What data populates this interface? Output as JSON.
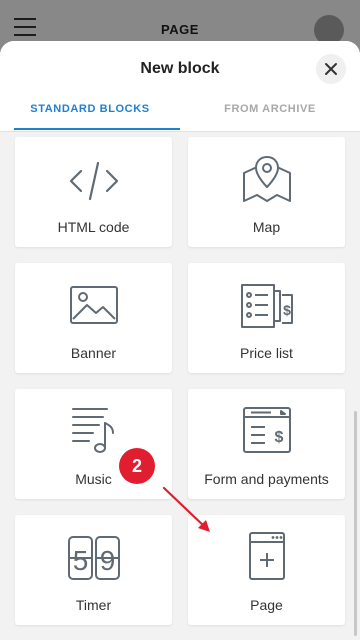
{
  "topbar": {
    "title": "PAGE"
  },
  "sheet": {
    "title": "New block",
    "tabs": [
      {
        "label": "STANDARD BLOCKS",
        "active": true
      },
      {
        "label": "FROM ARCHIVE",
        "active": false
      }
    ]
  },
  "blocks": [
    {
      "label": "HTML code",
      "icon": "code-icon"
    },
    {
      "label": "Map",
      "icon": "map-pin-icon"
    },
    {
      "label": "Banner",
      "icon": "image-icon"
    },
    {
      "label": "Price list",
      "icon": "price-list-icon"
    },
    {
      "label": "Music",
      "icon": "music-icon"
    },
    {
      "label": "Form and payments",
      "icon": "form-payment-icon"
    },
    {
      "label": "Timer",
      "icon": "timer-icon"
    },
    {
      "label": "Page",
      "icon": "page-add-icon"
    }
  ],
  "annotation": {
    "step": "2"
  },
  "colors": {
    "accent": "#1f7fd1",
    "badge": "#e01e30",
    "icon": "#5f6a74"
  }
}
